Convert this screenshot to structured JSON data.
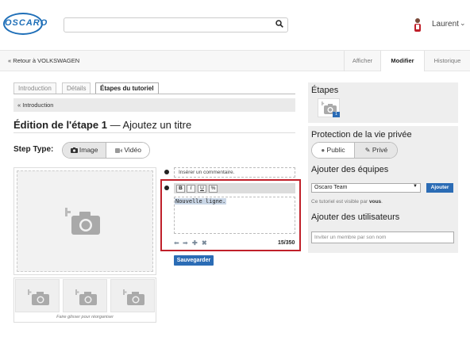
{
  "header": {
    "logo_text": "OSCARO",
    "search_placeholder": "",
    "user_name": "Laurent"
  },
  "subnav": {
    "back_link": "« Retour à VOLKSWAGEN",
    "tabs": [
      "Afficher",
      "Modifier",
      "Historique"
    ],
    "active_tab": "Modifier"
  },
  "editor": {
    "tabs": [
      "Introduction",
      "Détails",
      "Étapes du tutoriel"
    ],
    "active_tab": "Étapes du tutoriel",
    "intro_link": "« Introduction",
    "step_title_bold": "Édition de l'étape 1",
    "step_title_rest": " — Ajoutez un titre",
    "step_type_label": "Step Type:",
    "step_types": [
      "Image",
      "Vidéo"
    ],
    "selected_step_type": "Image",
    "drag_hint": "Faire glisser pour réorganiser",
    "comment_placeholder": "Insérer un commentaire.",
    "toolbar": [
      "B",
      "I",
      "U",
      "%"
    ],
    "text_value": "Nouvelle ligne.",
    "char_count": "15/350",
    "save_label": "Sauvegarder"
  },
  "sidebar": {
    "steps_title": "Étapes",
    "step_badge": "1",
    "privacy_title": "Protection de la vie privée",
    "privacy_options": [
      "Public",
      "Privé"
    ],
    "privacy_selected": "Privé",
    "teams_title": "Ajouter des équipes",
    "team_selected": "Oscaro Team",
    "add_team_label": "Ajouter",
    "visibility_prefix": "Ce tutoriel est visible par ",
    "visibility_bold": "vous",
    "visibility_suffix": ".",
    "users_title": "Ajouter des utilisateurs",
    "user_placeholder": "Inviter un membre par son nom"
  },
  "colors": {
    "accent": "#2b6cb5",
    "highlight": "#c0202a"
  }
}
